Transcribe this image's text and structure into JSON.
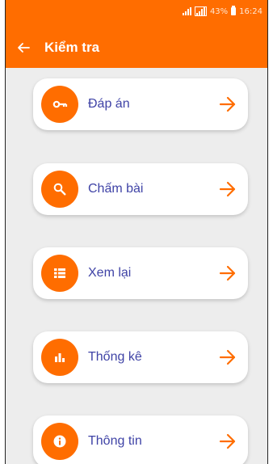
{
  "status": {
    "battery": "43%",
    "time": "16:24"
  },
  "appbar": {
    "title": "Kiểm tra"
  },
  "menu": [
    {
      "label": "Đáp án",
      "icon": "key-icon"
    },
    {
      "label": "Chấm bài",
      "icon": "search-icon"
    },
    {
      "label": "Xem lại",
      "icon": "list-icon"
    },
    {
      "label": "Thống kê",
      "icon": "bar-chart-icon"
    },
    {
      "label": "Thông tin",
      "icon": "info-icon"
    }
  ],
  "colors": {
    "accent": "#ff6d00",
    "label": "#3f43a6",
    "background": "#ededed"
  }
}
